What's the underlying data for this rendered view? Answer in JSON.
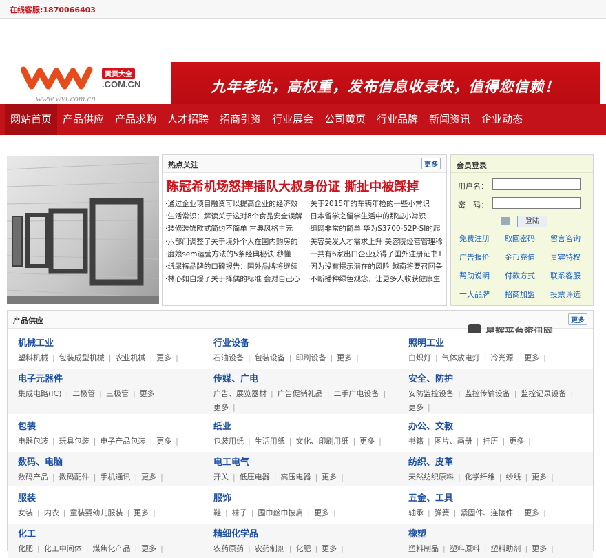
{
  "topbar": {
    "service": "在线客服:1870066403"
  },
  "logo": {
    "badge": "黄页大全",
    "domain": ".COM.CN",
    "url": "www.wvi.com.cn"
  },
  "banner": {
    "slogan": "九年老站，高权重，发布信息收录快，值得您信赖！"
  },
  "nav": {
    "items": [
      "网站首页",
      "产品供应",
      "产品求购",
      "人才招聘",
      "招商引资",
      "行业展会",
      "公司黄页",
      "行业品牌",
      "新闻资讯",
      "企业动态"
    ]
  },
  "hot": {
    "header": "热点关注",
    "more": "更多",
    "headline": "陈冠希机场怒摔插队大叔身份证 撕扯中被踩掉",
    "items": [
      "·通过企业项目融资可以提高企业的经济效",
      "·关于2015年的车辆年检的一些小常识",
      "·生活常识：解读关于这对8个食品安全误解",
      "·日本留学之留学生活中的那些小常识",
      "·装修装饰欧式简约不简单 古典风格主元",
      "·组网非常的简单 华为S3700-52P-SI的起",
      "·六部门调整了关于境外个人在国内购房的",
      "·美容美发人才需求上升 美容院经营管理稀",
      "·度娘sem运营方法的5条经典秘诀 秒懂",
      "·一共有6家出口企业获得了国外注册证书1",
      "·纸尿裤品牌的口碑报告：国外品牌将继续",
      "·因为没有提示潜在的风险 越南将要召回争",
      "·林心如自爆了关于择偶的标准 会对自己心",
      "·不断播种绿色观念，让更多人收获健康生"
    ]
  },
  "login": {
    "header": "会员登录",
    "user_label": "用户名：",
    "pass_label": "密　码：",
    "button": "登陆",
    "links": [
      "免费注册",
      "取回密码",
      "留言咨询",
      "广告报价",
      "金币充值",
      "贵宾特权",
      "帮助说明",
      "付款方式",
      "联系客服",
      "十大品牌",
      "招商加盟",
      "投票评选"
    ]
  },
  "products": {
    "header": "产品供应",
    "more": "更多",
    "watermark": "星辉平台资讯网",
    "rows": [
      [
        {
          "title": "机械工业",
          "subs": [
            "塑料机械",
            "包装成型机械",
            "农业机械",
            "更多"
          ]
        },
        {
          "title": "行业设备",
          "subs": [
            "石油设备",
            "包装设备",
            "印刷设备",
            "更多"
          ]
        },
        {
          "title": "照明工业",
          "subs": [
            "白炽灯",
            "气体放电灯",
            "冷光源",
            "更多"
          ]
        }
      ],
      [
        {
          "title": "电子元器件",
          "subs": [
            "集成电路(IC)",
            "二极管",
            "三极管",
            "更多"
          ]
        },
        {
          "title": "传媒、广电",
          "subs": [
            "广告、展览器材",
            "广告促销礼品",
            "二手广电设备",
            "更多"
          ]
        },
        {
          "title": "安全、防护",
          "subs": [
            "安防监控设备",
            "监控传输设备",
            "监控记录设备",
            "更多"
          ]
        }
      ],
      [
        {
          "title": "包装",
          "subs": [
            "电器包装",
            "玩具包装",
            "电子产品包装",
            "更多"
          ]
        },
        {
          "title": "纸业",
          "subs": [
            "包装用纸",
            "生活用纸",
            "文化、印刷用纸",
            "更多"
          ]
        },
        {
          "title": "办公、文教",
          "subs": [
            "书籍",
            "图片、画册",
            "挂历",
            "更多"
          ]
        }
      ],
      [
        {
          "title": "数码、电脑",
          "subs": [
            "数码产品",
            "数码配件",
            "手机通讯",
            "更多"
          ]
        },
        {
          "title": "电工电气",
          "subs": [
            "开关",
            "低压电器",
            "高压电器",
            "更多"
          ]
        },
        {
          "title": "纺织、皮革",
          "subs": [
            "天然纺织原料",
            "化学纤维",
            "纱线",
            "更多"
          ]
        }
      ],
      [
        {
          "title": "服装",
          "subs": [
            "女装",
            "内衣",
            "童装婴幼儿服装",
            "更多"
          ]
        },
        {
          "title": "服饰",
          "subs": [
            "鞋",
            "袜子",
            "围巾丝巾披肩",
            "更多"
          ]
        },
        {
          "title": "五金、工具",
          "subs": [
            "轴承",
            "弹簧",
            "紧固件、连接件",
            "更多"
          ]
        }
      ],
      [
        {
          "title": "化工",
          "subs": [
            "化肥",
            "化工中间体",
            "煤焦化产品",
            "更多"
          ]
        },
        {
          "title": "精细化学品",
          "subs": [
            "农药原药",
            "农药制剂",
            "化肥",
            "更多"
          ]
        },
        {
          "title": "橡塑",
          "subs": [
            "塑料制品",
            "塑料原料",
            "塑料助剂",
            "更多"
          ]
        }
      ]
    ]
  }
}
